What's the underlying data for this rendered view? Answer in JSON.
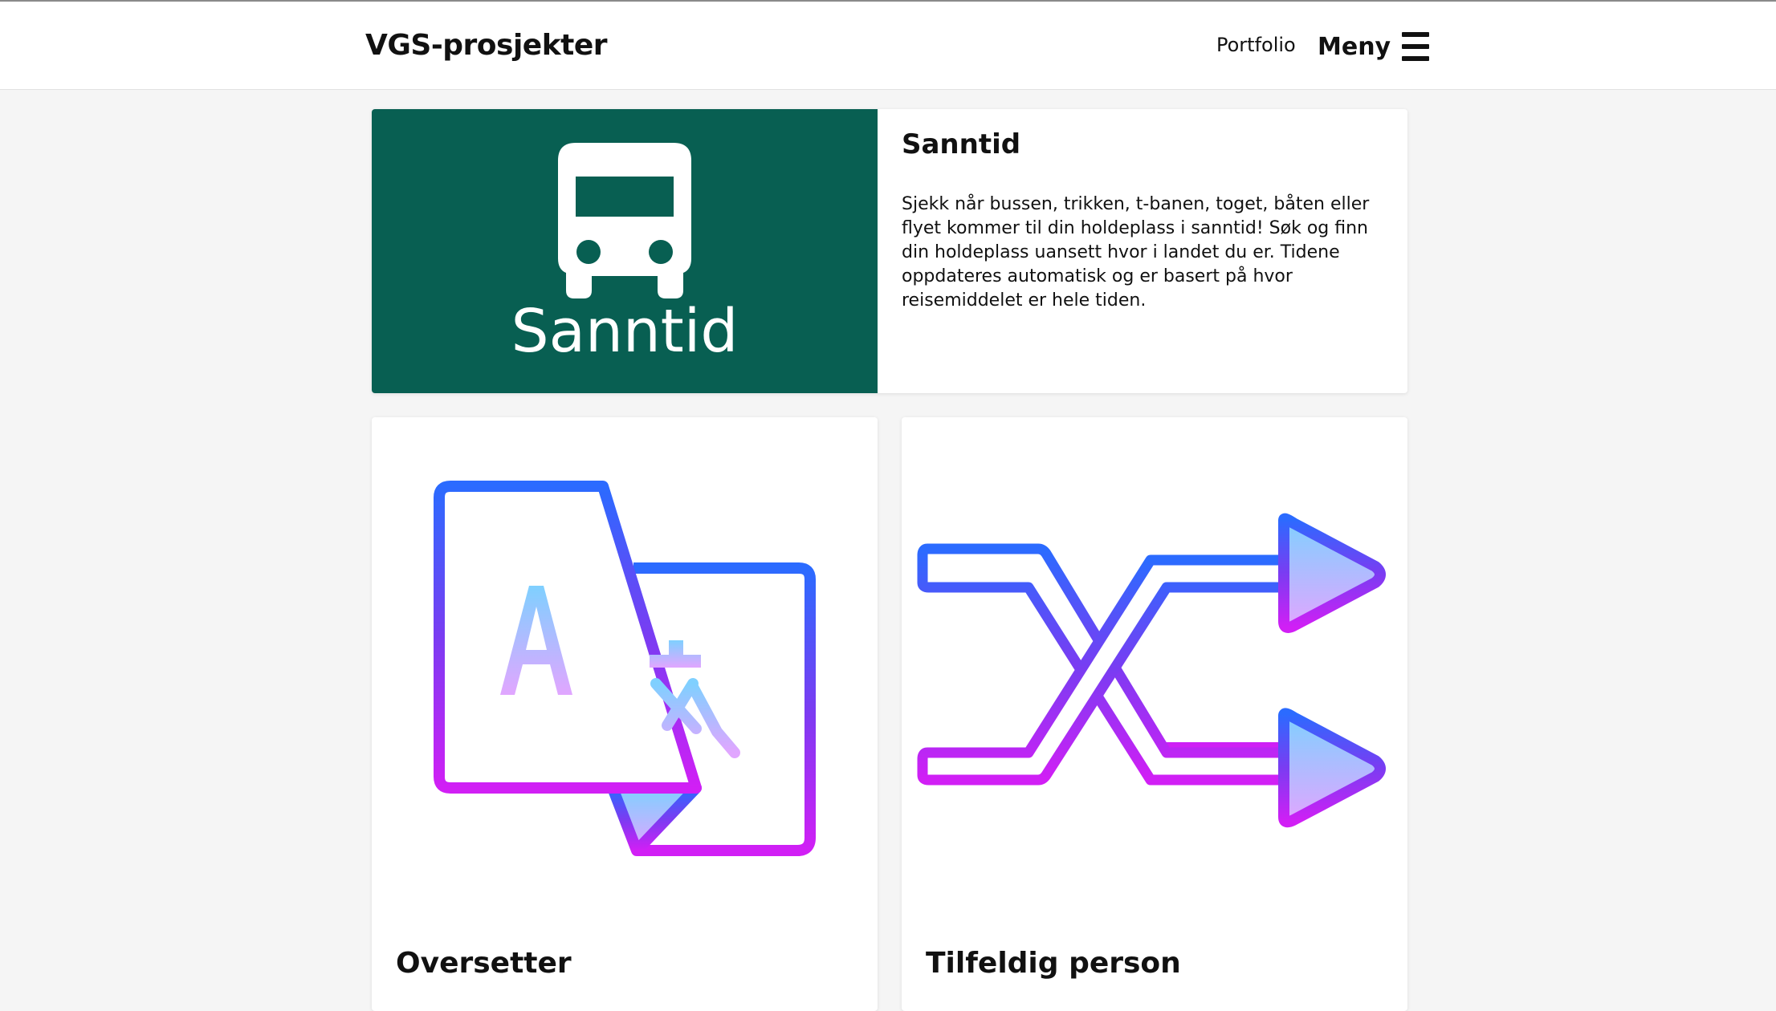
{
  "header": {
    "brand": "VGS-prosjekter",
    "nav_portfolio": "Portfolio",
    "nav_menu": "Meny"
  },
  "cards": [
    {
      "image_text": "Sanntid",
      "image_icon": "bus-icon",
      "image_bg": "#085f52",
      "title": "Sanntid",
      "description": "Sjekk når bussen, trikken, t-banen, toget, båten eller flyet kommer til din holdeplass i sanntid! Søk og finn din holdeplass uansett hvor i landet du er. Tidene oppdateres automatisk og er basert på hvor reisemiddelet er hele tiden."
    },
    {
      "title": "Oversetter",
      "image_icon": "translate-icon"
    },
    {
      "title": "Tilfeldig person",
      "image_icon": "shuffle-icon"
    }
  ],
  "colors": {
    "gradient_top": "#2b6bff",
    "gradient_mid": "#7a3cf2",
    "gradient_bottom": "#d11ff5",
    "fill_light_top": "#7fd0ff",
    "fill_light_bottom": "#e1a6ff"
  }
}
